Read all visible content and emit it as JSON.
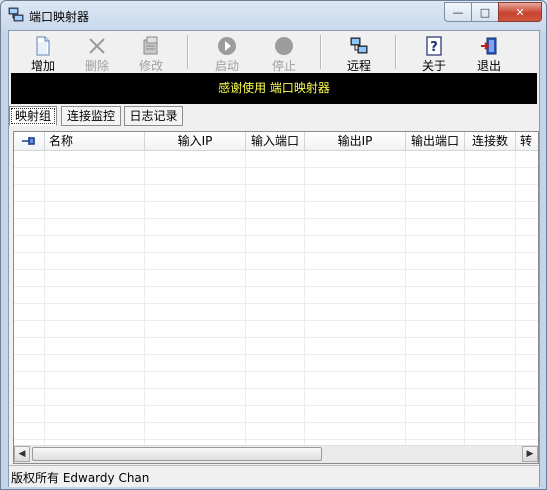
{
  "window": {
    "title": "端口映射器",
    "minimize_glyph": "—",
    "maximize_glyph": "□",
    "close_glyph": "✕"
  },
  "toolbar": {
    "buttons": [
      {
        "label": "增加",
        "icon": "add-document-icon",
        "enabled": true
      },
      {
        "label": "删除",
        "icon": "delete-x-icon",
        "enabled": false
      },
      {
        "label": "修改",
        "icon": "edit-icon",
        "enabled": false
      },
      {
        "label": "启动",
        "icon": "play-icon",
        "enabled": false
      },
      {
        "label": "停止",
        "icon": "stop-icon",
        "enabled": false
      },
      {
        "label": "远程",
        "icon": "network-computers-icon",
        "enabled": true
      },
      {
        "label": "关于",
        "icon": "help-icon",
        "enabled": true
      },
      {
        "label": "退出",
        "icon": "exit-door-icon",
        "enabled": true
      }
    ]
  },
  "banner": {
    "text": "感谢使用 端口映射器",
    "text_color": "#ffff55",
    "background": "#000000"
  },
  "tabs": [
    {
      "label": "映射组",
      "active": true
    },
    {
      "label": "连接监控",
      "active": false
    },
    {
      "label": "日志记录",
      "active": false
    }
  ],
  "list": {
    "pin_icon": "pin-icon",
    "columns": [
      "名称",
      "输入IP",
      "输入端口",
      "输出IP",
      "输出端口",
      "连接数",
      "转"
    ],
    "rows": []
  },
  "scrollbar": {
    "left_arrow": "◀",
    "right_arrow": "▶"
  },
  "status": {
    "text": "版权所有 Edwardy Chan"
  }
}
